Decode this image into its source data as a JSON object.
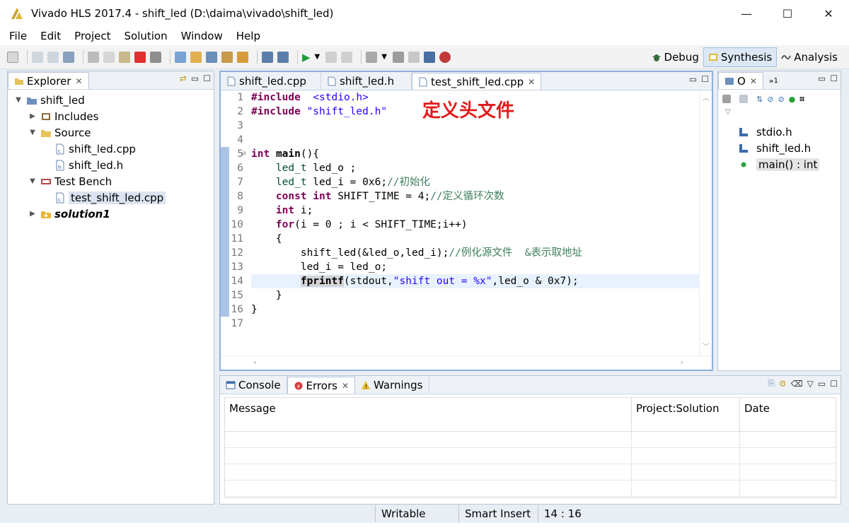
{
  "window": {
    "title": "Vivado HLS 2017.4 - shift_led (D:\\daima\\vivado\\shift_led)",
    "minimize": "—",
    "maximize": "☐",
    "close": "✕"
  },
  "menu": [
    "File",
    "Edit",
    "Project",
    "Solution",
    "Window",
    "Help"
  ],
  "perspectives": {
    "debug": "Debug",
    "synthesis": "Synthesis",
    "analysis": "Analysis"
  },
  "explorer": {
    "tab_label": "Explorer",
    "tree": {
      "project": "shift_led",
      "includes": "Includes",
      "source": "Source",
      "source_files": [
        "shift_led.cpp",
        "shift_led.h"
      ],
      "test_bench": "Test Bench",
      "test_bench_files": [
        "test_shift_led.cpp"
      ],
      "solution": "solution1"
    }
  },
  "editor": {
    "tabs": [
      "shift_led.cpp",
      "shift_led.h",
      "test_shift_led.cpp"
    ],
    "active_tab": "test_shift_led.cpp",
    "line_numbers": [
      "1",
      "2",
      "3",
      "4",
      "5",
      "6",
      "7",
      "8",
      "9",
      "10",
      "11",
      "12",
      "13",
      "14",
      "15",
      "16",
      "17"
    ],
    "lines": [
      "#include  <stdio.h>",
      "#include \"shift_led.h\"",
      "",
      "",
      "int main(){",
      "    led_t led_o ;",
      "    led_t led_i = 0x6;//初始化",
      "    const int SHIFT_TIME = 4;//定义循环次数",
      "    int i;",
      "    for(i = 0 ; i < SHIFT_TIME;i++)",
      "    {",
      "        shift_led(&led_o,led_i);//例化源文件  &表示取地址",
      "        led_i = led_o;",
      "        fprintf(stdout,\"shift out = %x\",led_o & 0x7);",
      "    }",
      "}",
      ""
    ],
    "annotation": "定义头文件"
  },
  "outline": {
    "tab_label": "O",
    "extra_tab": "1",
    "items": [
      "stdio.h",
      "shift_led.h",
      "main() : int"
    ]
  },
  "bottom": {
    "tabs": [
      "Console",
      "Errors",
      "Warnings"
    ],
    "columns": [
      "Message",
      "Project:Solution",
      "Date"
    ]
  },
  "status": {
    "mode": "Writable",
    "insert": "Smart Insert",
    "position": "14 : 16"
  }
}
